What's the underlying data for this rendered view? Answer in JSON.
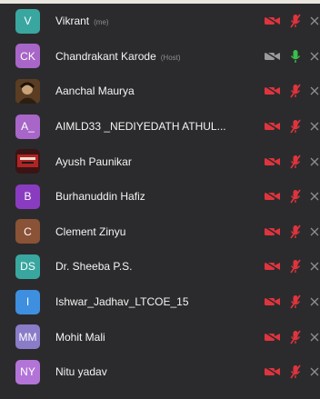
{
  "colors": {
    "muted_red": "#e0343d",
    "live_green": "#39c24a",
    "cam_off_gray": "#9a9a9f"
  },
  "participants": [
    {
      "initials": "V",
      "avatar_color": "#3aa6a0",
      "name": "Vikrant",
      "role": "(me)",
      "video_icon": "video-off-icon",
      "mic_icon": "mic-muted-icon"
    },
    {
      "initials": "CK",
      "avatar_color": "#a866c8",
      "name": "Chandrakant Karode",
      "role": "(Host)",
      "video_icon": "video-off-icon",
      "mic_icon": "mic-on-icon"
    },
    {
      "initials": "",
      "avatar_color": "#6b4a2a",
      "name": "Aanchal Maurya",
      "role": "",
      "video_icon": "video-off-icon",
      "mic_icon": "mic-muted-icon"
    },
    {
      "initials": "A_",
      "avatar_color": "#a866c8",
      "name": "AIMLD33 _NEDIYEDATH ATHUL...",
      "role": "",
      "video_icon": "video-off-icon",
      "mic_icon": "mic-muted-icon"
    },
    {
      "initials": "",
      "avatar_color": "#7a2a2a",
      "name": "Ayush Paunikar",
      "role": "",
      "video_icon": "video-off-icon",
      "mic_icon": "mic-muted-icon"
    },
    {
      "initials": "B",
      "avatar_color": "#8a3cc0",
      "name": "Burhanuddin Hafiz",
      "role": "",
      "video_icon": "video-off-icon",
      "mic_icon": "mic-muted-icon"
    },
    {
      "initials": "C",
      "avatar_color": "#8a5236",
      "name": "Clement Zinyu",
      "role": "",
      "video_icon": "video-off-icon",
      "mic_icon": "mic-muted-icon"
    },
    {
      "initials": "DS",
      "avatar_color": "#3aa6a0",
      "name": "Dr. Sheeba P.S.",
      "role": "",
      "video_icon": "video-off-icon",
      "mic_icon": "mic-muted-icon"
    },
    {
      "initials": "I",
      "avatar_color": "#3f8fe0",
      "name": "Ishwar_Jadhav_LTCOE_15",
      "role": "",
      "video_icon": "video-off-icon",
      "mic_icon": "mic-muted-icon"
    },
    {
      "initials": "MM",
      "avatar_color": "#8a7cc8",
      "name": "Mohit Mali",
      "role": "",
      "video_icon": "video-off-icon",
      "mic_icon": "mic-muted-icon"
    },
    {
      "initials": "NY",
      "avatar_color": "#b374d8",
      "name": "Nitu yadav",
      "role": "",
      "video_icon": "video-off-icon",
      "mic_icon": "mic-muted-icon"
    }
  ]
}
